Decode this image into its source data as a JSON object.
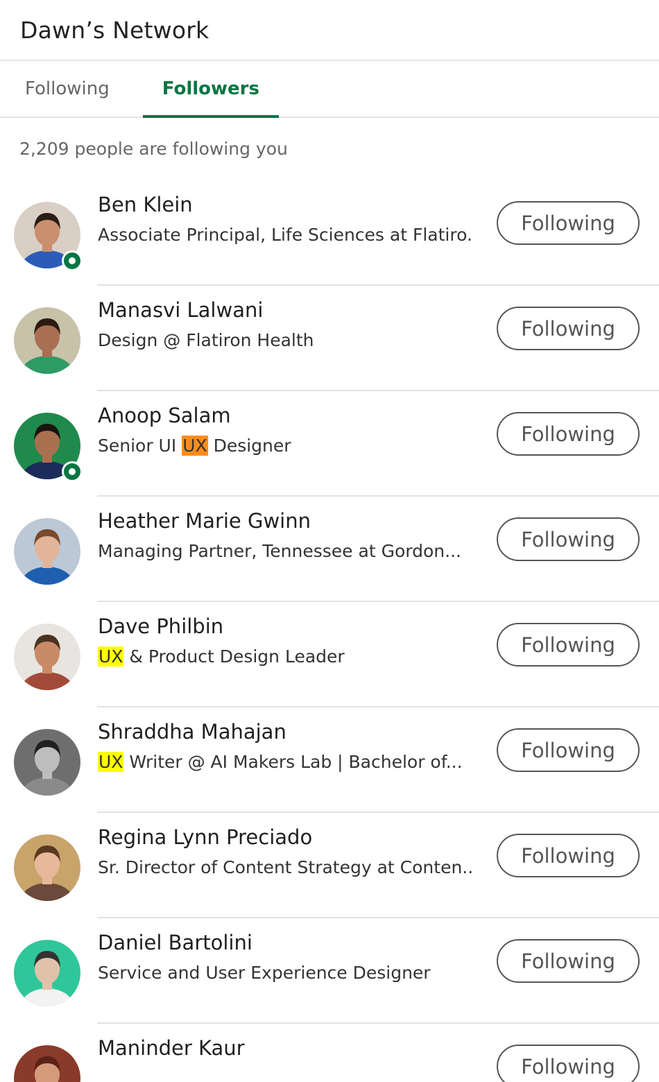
{
  "header": {
    "title": "Dawn’s Network"
  },
  "tabs": [
    {
      "label": "Following",
      "active": false
    },
    {
      "label": "Followers",
      "active": true
    }
  ],
  "colors": {
    "accent": "#057642",
    "highlight_yellow": "#ffff00",
    "highlight_orange": "#ff8c1a"
  },
  "followers": {
    "summary": "2,209 people are following you",
    "people": [
      {
        "name": "Ben Klein",
        "headline": [
          {
            "text": "Associate Principal, Life Sciences at Flatiro..."
          }
        ],
        "button": "Following",
        "online": true
      },
      {
        "name": "Manasvi Lalwani",
        "headline": [
          {
            "text": "Design @ Flatiron Health"
          }
        ],
        "button": "Following",
        "online": false
      },
      {
        "name": "Anoop Salam",
        "headline": [
          {
            "text": "Senior UI "
          },
          {
            "text": "UX",
            "highlight": "#ff8c1a"
          },
          {
            "text": " Designer"
          }
        ],
        "button": "Following",
        "online": true
      },
      {
        "name": "Heather Marie Gwinn",
        "headline": [
          {
            "text": "Managing Partner, Tennessee at Gordon..."
          }
        ],
        "button": "Following",
        "online": false
      },
      {
        "name": "Dave Philbin",
        "headline": [
          {
            "text": "UX",
            "highlight": "#ffff00"
          },
          {
            "text": " & Product Design Leader"
          }
        ],
        "button": "Following",
        "online": false
      },
      {
        "name": "Shraddha Mahajan",
        "headline": [
          {
            "text": "UX",
            "highlight": "#ffff00"
          },
          {
            "text": " Writer @ AI Makers Lab | Bachelor of..."
          }
        ],
        "button": "Following",
        "online": false
      },
      {
        "name": "Regina Lynn Preciado",
        "headline": [
          {
            "text": "Sr. Director of Content Strategy at Conten..."
          }
        ],
        "button": "Following",
        "online": false
      },
      {
        "name": "Daniel Bartolini",
        "headline": [
          {
            "text": "Service and User Experience Designer"
          }
        ],
        "button": "Following",
        "online": false
      },
      {
        "name": "Maninder Kaur",
        "headline": [],
        "button": "Following",
        "online": false
      }
    ]
  }
}
